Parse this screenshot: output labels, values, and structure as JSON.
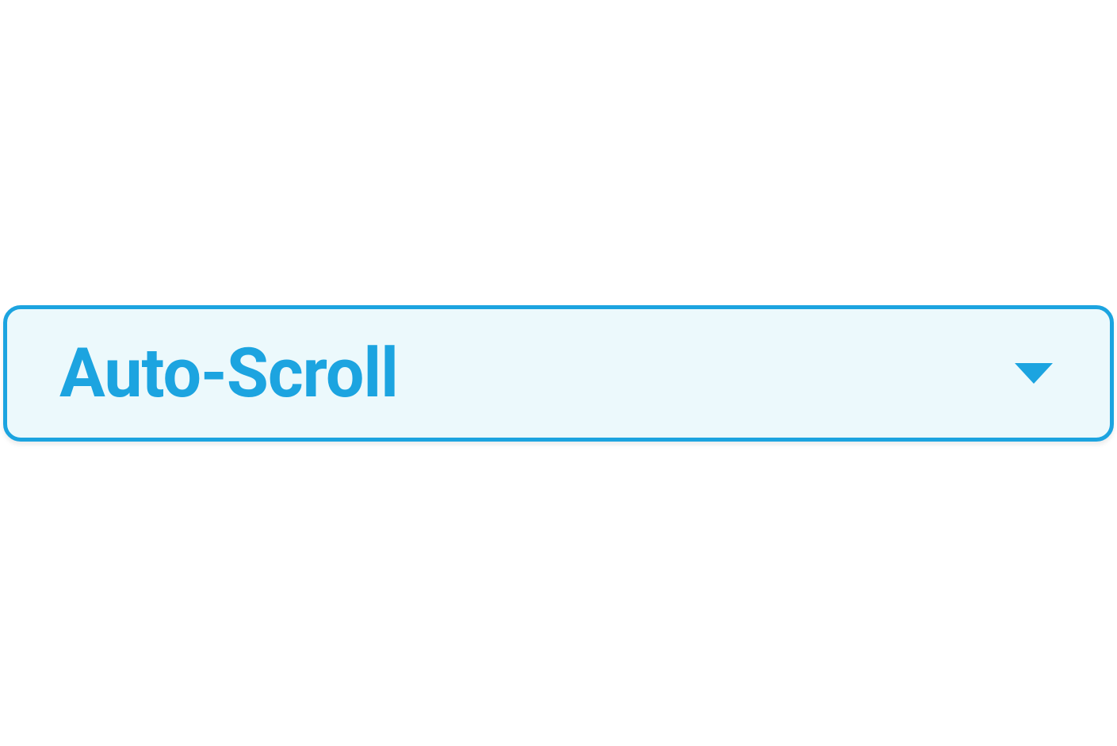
{
  "dropdown": {
    "label": "Auto-Scroll",
    "expanded": false,
    "colors": {
      "border": "#1ca4e0",
      "background": "#ecf9fc",
      "text": "#1ca4e0"
    }
  }
}
